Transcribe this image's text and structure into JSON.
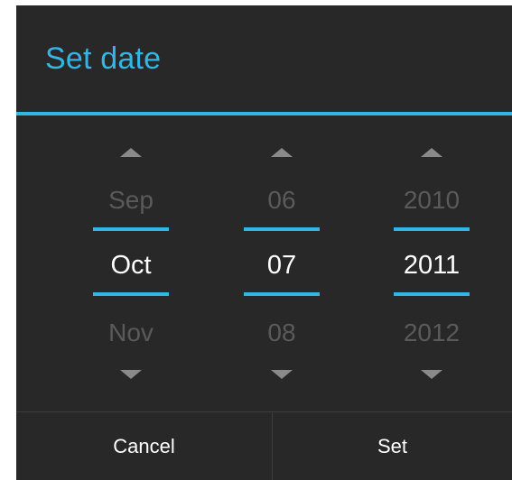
{
  "dialog": {
    "title": "Set date"
  },
  "picker": {
    "month": {
      "prev": "Sep",
      "current": "Oct",
      "next": "Nov"
    },
    "day": {
      "prev": "06",
      "current": "07",
      "next": "08"
    },
    "year": {
      "prev": "2010",
      "current": "2011",
      "next": "2012"
    }
  },
  "buttons": {
    "cancel": "Cancel",
    "set": "Set"
  },
  "icons": {
    "increment": "triangle-up-icon",
    "decrement": "triangle-down-icon"
  },
  "colors": {
    "accent": "#33b5e5",
    "background": "#282828",
    "text": "#ffffff",
    "dim_text": "#5a5a5a"
  }
}
